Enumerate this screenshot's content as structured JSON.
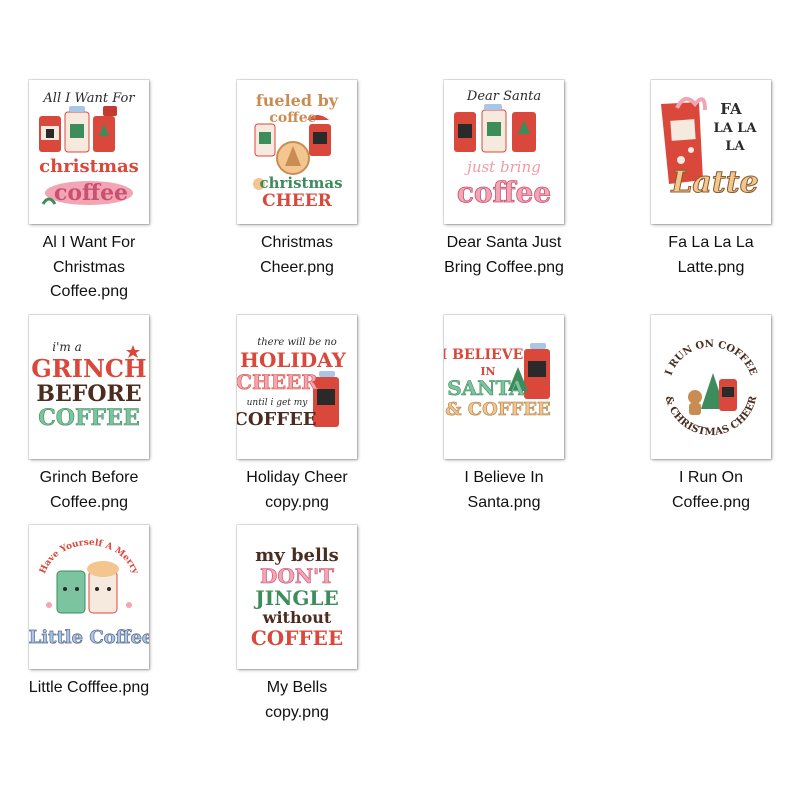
{
  "files": [
    {
      "name": "Al I Want For\nChristmas\nCoffee.png",
      "icon": "image-thumbnail-icon"
    },
    {
      "name": "Christmas\nCheer.png",
      "icon": "image-thumbnail-icon"
    },
    {
      "name": "Dear Santa Just\nBring Coffee.png",
      "icon": "image-thumbnail-icon"
    },
    {
      "name": "Fa La La La\nLatte.png",
      "icon": "image-thumbnail-icon"
    },
    {
      "name": "Grinch Before\nCoffee.png",
      "icon": "image-thumbnail-icon"
    },
    {
      "name": "Holiday Cheer\ncopy.png",
      "icon": "image-thumbnail-icon"
    },
    {
      "name": "I Believe In\nSanta.png",
      "icon": "image-thumbnail-icon"
    },
    {
      "name": "I Run On\nCoffee.png",
      "icon": "image-thumbnail-icon"
    },
    {
      "name": "Little Cofffee.png",
      "icon": "image-thumbnail-icon"
    },
    {
      "name": "My Bells\ncopy.png",
      "icon": "image-thumbnail-icon"
    }
  ],
  "thumbnails": [
    {
      "lines": [
        "All I Want For",
        "christmas",
        "coffee"
      ]
    },
    {
      "lines": [
        "fueled by",
        "coffee",
        "christmas",
        "CHEER"
      ]
    },
    {
      "lines": [
        "Dear Santa",
        "just bring",
        "coffee"
      ]
    },
    {
      "lines": [
        "FA",
        "LA LA",
        "LA",
        "Latte"
      ]
    },
    {
      "lines": [
        "i'm a",
        "GRINCH",
        "BEFORE",
        "COFFEE"
      ]
    },
    {
      "lines": [
        "there will be no",
        "HOLIDAY",
        "CHEER",
        "until i get my",
        "COFFEE"
      ]
    },
    {
      "lines": [
        "I BELIEVE",
        "IN",
        "SANTA",
        "& COFFEE"
      ]
    },
    {
      "lines": [
        "I RUN ON COFFEE",
        "& CHRISTMAS CHEER"
      ]
    },
    {
      "lines": [
        "Have Yourself A Merry",
        "Little Coffee"
      ]
    },
    {
      "lines": [
        "my bells",
        "DON'T",
        "JINGLE",
        "without",
        "COFFEE"
      ]
    }
  ],
  "colors": {
    "red": "#d9483b",
    "green": "#3d8c5c",
    "mint": "#7cc3a0",
    "pink": "#f2a5b3",
    "brown": "#4a2c20",
    "cream": "#f3c690",
    "blue": "#a9c6e8",
    "gray": "#9aa9c4"
  }
}
